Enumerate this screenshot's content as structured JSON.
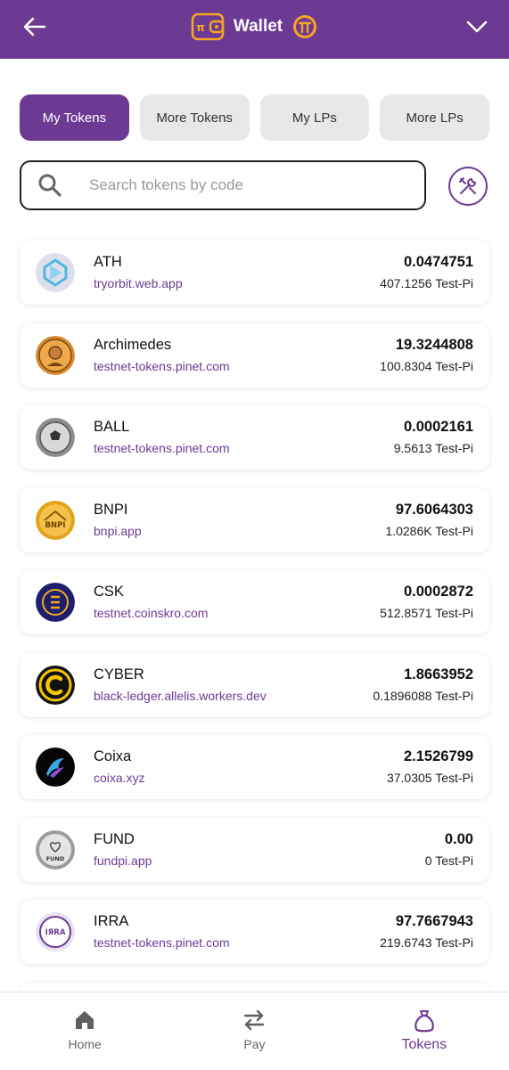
{
  "header": {
    "title": "Wallet",
    "wallet_logo_glyph": "π"
  },
  "tabs": [
    {
      "label": "My Tokens"
    },
    {
      "label": "More Tokens"
    },
    {
      "label": "My LPs"
    },
    {
      "label": "More LPs"
    }
  ],
  "search": {
    "placeholder": "Search tokens by code",
    "value": ""
  },
  "tokens": [
    {
      "code": "ATH",
      "domain": "tryorbit.web.app",
      "amount": "0.0474751",
      "value": "407.1256 Test-Pi",
      "logo_text": ""
    },
    {
      "code": "Archimedes",
      "domain": "testnet-tokens.pinet.com",
      "amount": "19.3244808",
      "value": "100.8304 Test-Pi",
      "logo_text": ""
    },
    {
      "code": "BALL",
      "domain": "testnet-tokens.pinet.com",
      "amount": "0.0002161",
      "value": "9.5613 Test-Pi",
      "logo_text": ""
    },
    {
      "code": "BNPI",
      "domain": "bnpi.app",
      "amount": "97.6064303",
      "value": "1.0286K Test-Pi",
      "logo_text": "BNPI"
    },
    {
      "code": "CSK",
      "domain": "testnet.coinskro.com",
      "amount": "0.0002872",
      "value": "512.8571 Test-Pi",
      "logo_text": ""
    },
    {
      "code": "CYBER",
      "domain": "black-ledger.allelis.workers.dev",
      "amount": "1.8663952",
      "value": "0.1896088 Test-Pi",
      "logo_text": ""
    },
    {
      "code": "Coixa",
      "domain": "coixa.xyz",
      "amount": "2.1526799",
      "value": "37.0305 Test-Pi",
      "logo_text": ""
    },
    {
      "code": "FUND",
      "domain": "fundpi.app",
      "amount": "0.00",
      "value": "0 Test-Pi",
      "logo_text": "FUND"
    },
    {
      "code": "IRRA",
      "domain": "testnet-tokens.pinet.com",
      "amount": "97.7667943",
      "value": "219.6743 Test-Pi",
      "logo_text": "IЯRA"
    }
  ],
  "bottom_nav": [
    {
      "label": "Home",
      "icon": "home-icon"
    },
    {
      "label": "Pay",
      "icon": "swap-arrows-icon"
    },
    {
      "label": "Tokens",
      "icon": "money-bag-icon"
    }
  ],
  "colors": {
    "brand": "#6d3a93",
    "pi_orange": "#f5a623"
  }
}
